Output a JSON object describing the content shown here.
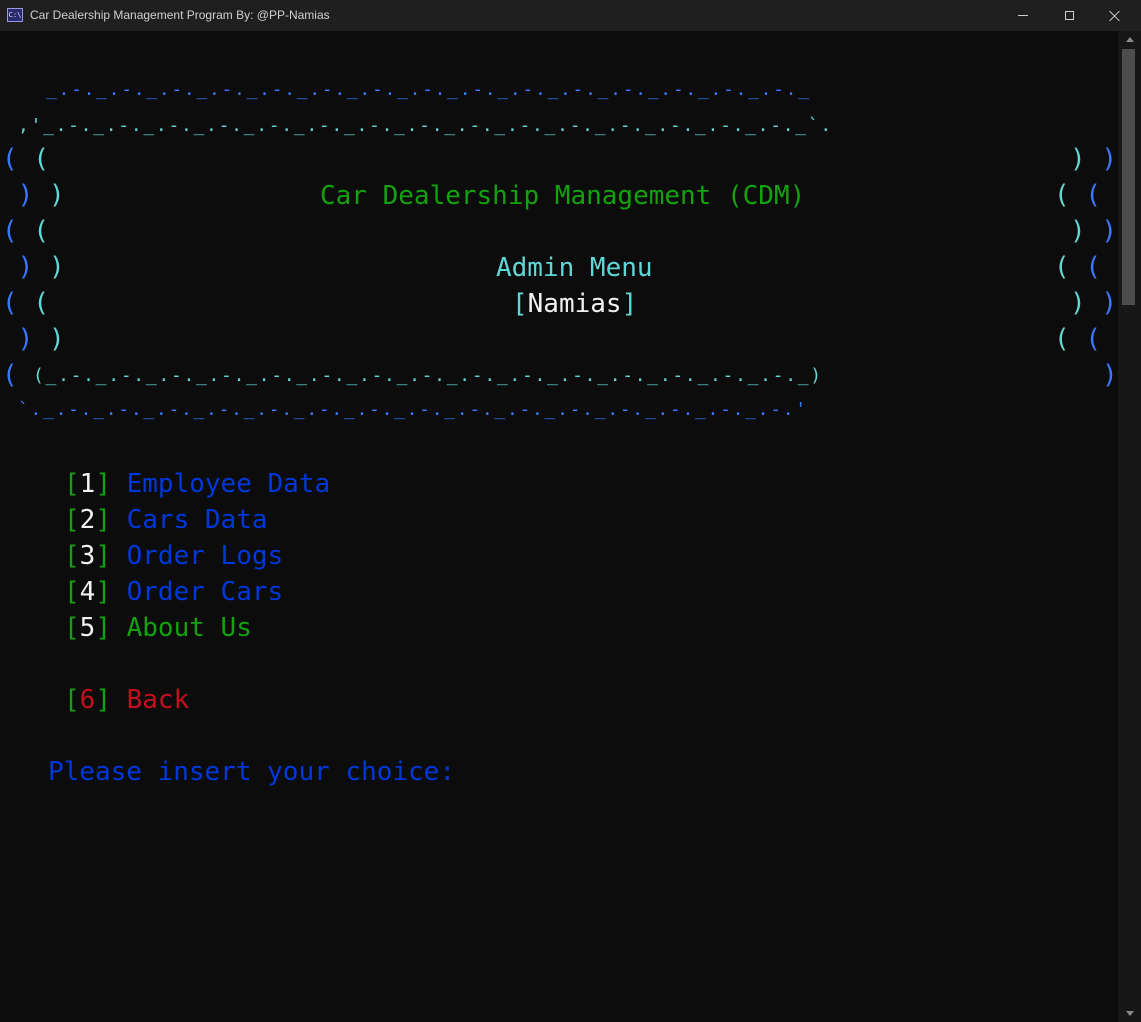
{
  "window": {
    "title": "Car Dealership Management Program By: @PP-Namias",
    "icon_text": "C:\\"
  },
  "banner": {
    "art_top_outer": "_.-._.-._.-._.-._.-._.-._.-._.-._.-._.-._.-._.-._.-._.-._.-._",
    "art_top_inner": ",'_.-._.-._.-._.-._.-._.-._.-._.-._.-._.-._.-._.-._.-._.-._.-._`.",
    "art_bottom_inner": "(_.-._.-._.-._.-._.-._.-._.-._.-._.-._.-._.-._.-._.-._.-._.-._)",
    "art_bottom_outer": "`._.-._.-._.-._.-._.-._.-._.-._.-._.-._.-._.-._.-._.-._.-._.-.'",
    "left_paren_a": "( (",
    "left_paren_b": " ) )",
    "right_paren_a": ") )",
    "right_paren_b": "( (",
    "title": "Car Dealership Management (CDM)",
    "subtitle": "Admin Menu",
    "user_open": "[",
    "user_name": "Namias",
    "user_close": "]"
  },
  "menu": {
    "items": [
      {
        "open": "[",
        "number": "1",
        "close": "]",
        "label": "Employee Data"
      },
      {
        "open": "[",
        "number": "2",
        "close": "]",
        "label": "Cars Data"
      },
      {
        "open": "[",
        "number": "3",
        "close": "]",
        "label": "Order Logs"
      },
      {
        "open": "[",
        "number": "4",
        "close": "]",
        "label": "Order Cars"
      },
      {
        "open": "[",
        "number": "5",
        "close": "]",
        "label": "About Us"
      }
    ],
    "back": {
      "open": "[",
      "number": "6",
      "close": "]",
      "label": "Back"
    }
  },
  "prompt": {
    "text": "Please insert your choice:"
  },
  "colors": {
    "background": "#0c0c0c",
    "cyan": "#61d6d6",
    "blue": "#3b78ff",
    "green": "#13a10e",
    "dark_blue": "#0037da",
    "red": "#c50f1f",
    "white": "#f2f2f2"
  },
  "icons": {
    "minimize": "minimize-icon",
    "maximize": "maximize-icon",
    "close": "close-icon",
    "scroll_up": "arrow-up-icon",
    "scroll_down": "arrow-down-icon"
  }
}
